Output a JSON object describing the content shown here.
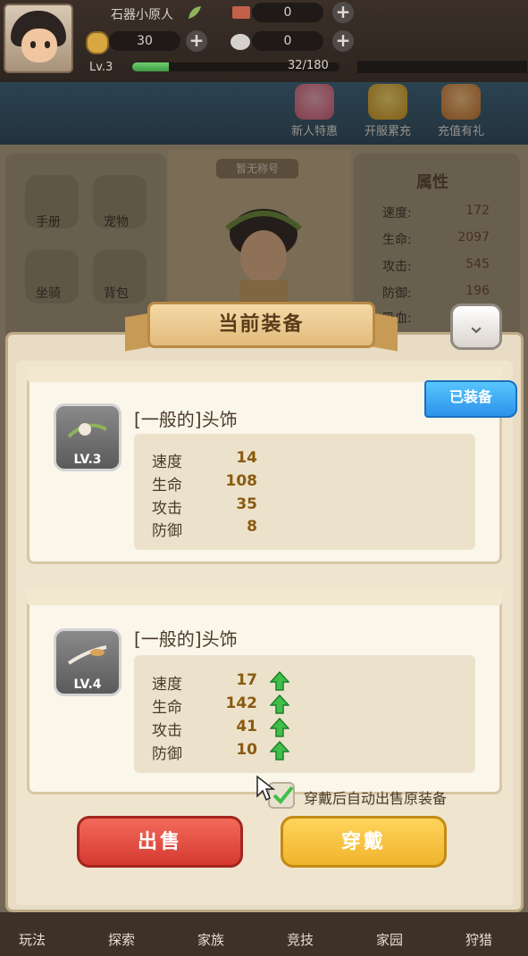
{
  "header": {
    "player_name": "石器小原人",
    "resource1_value": "0",
    "coins_value": "30",
    "resource3_value": "0",
    "level_label": "Lv.3",
    "xp_text": "32/180",
    "xp_progress": 0.178
  },
  "events": [
    {
      "label": "新人特惠",
      "icon": "girl-character-icon"
    },
    {
      "label": "开服累充",
      "icon": "medal-icon"
    },
    {
      "label": "充值有礼",
      "icon": "gift-chest-icon"
    }
  ],
  "background_panel": {
    "menu": [
      {
        "label": "手册",
        "icon": "book-icon"
      },
      {
        "label": "宠物",
        "icon": "pet-icon"
      },
      {
        "label": "坐骑",
        "icon": "mount-icon"
      },
      {
        "label": "背包",
        "icon": "bag-icon"
      }
    ],
    "center_tag": "暂无称号",
    "attributes_title": "属性",
    "attributes": [
      {
        "name": "速度:",
        "value": "172"
      },
      {
        "name": "生命:",
        "value": "2097"
      },
      {
        "name": "攻击:",
        "value": "545"
      },
      {
        "name": "防御:",
        "value": "196"
      },
      {
        "name": "吸血:",
        "value": ""
      }
    ]
  },
  "modal": {
    "title": "当前装备",
    "collapse_icon": "chevron-down-icon",
    "equipped_badge": "已装备",
    "current_item": {
      "name": "[一般的]头饰",
      "level": "LV.3",
      "stats": [
        {
          "name": "速度",
          "value": "14"
        },
        {
          "name": "生命",
          "value": "108"
        },
        {
          "name": "攻击",
          "value": "35"
        },
        {
          "name": "防御",
          "value": "8"
        }
      ]
    },
    "new_item": {
      "name": "[一般的]头饰",
      "level": "LV.4",
      "stats": [
        {
          "name": "速度",
          "value": "17"
        },
        {
          "name": "生命",
          "value": "142"
        },
        {
          "name": "攻击",
          "value": "41"
        },
        {
          "name": "防御",
          "value": "10"
        }
      ]
    },
    "auto_sell_label": "穿戴后自动出售原装备",
    "auto_sell_checked": true,
    "sell_button": "出售",
    "equip_button": "穿戴"
  },
  "bottom_nav": [
    "玩法",
    "探索",
    "家族",
    "竞技",
    "家园",
    "狩猎"
  ],
  "colors": {
    "sell": "#e0483b",
    "equip": "#f5c040",
    "badge": "#3aa8f2",
    "stat_value": "#8b5a0f",
    "up_arrow": "#3fbf4a"
  }
}
